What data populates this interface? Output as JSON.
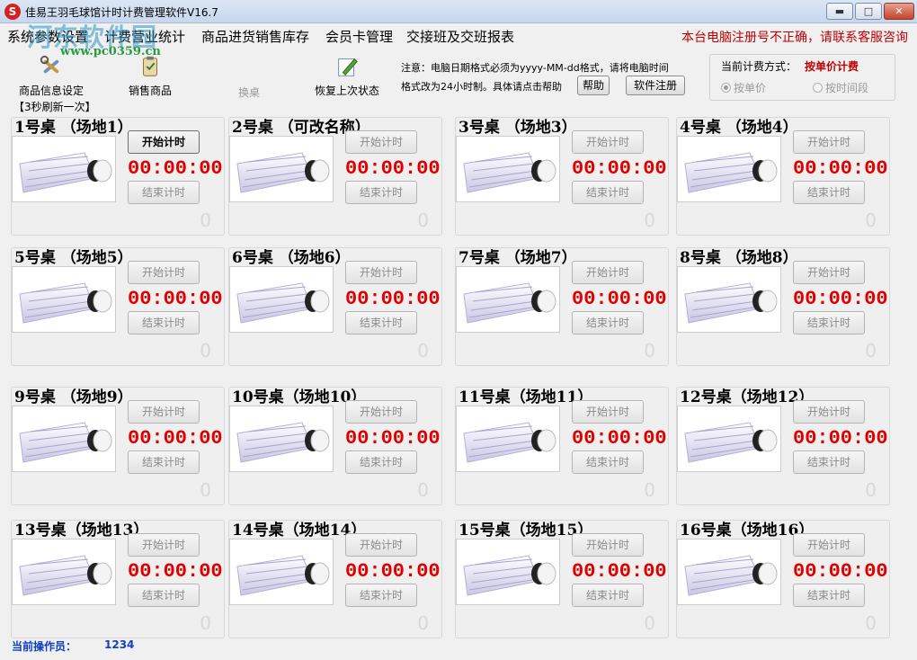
{
  "window": {
    "title": "佳易王羽毛球馆计时计费管理软件V16.7",
    "icon_glyph": "S",
    "btn_min": "▬",
    "btn_max": "□",
    "btn_close": "✕"
  },
  "watermark": {
    "text": "河东软件园",
    "url": "www.pc0359.cn"
  },
  "menu": {
    "items": [
      "系统参数设置",
      "计费营业统计",
      "商品进货销售库存",
      "会员卡管理",
      "交接班及交班报表"
    ],
    "reg_warning": "本台电脑注册号不正确，请联系客服咨询"
  },
  "toolbar": {
    "product_info": "商品信息设定",
    "sell_product": "销售商品",
    "change_table": "换桌",
    "restore_state": "恢复上次状态",
    "notice_line1": "注意：电脑日期格式必须为yyyy-MM-dd格式，请将电脑时间",
    "notice_line2": "格式改为24小时制。具体请点击帮助",
    "help_button": "帮助",
    "register_button": "软件注册"
  },
  "fee": {
    "label": "当前计费方式：",
    "value": "按单价计费",
    "opt_unit": "按单价",
    "opt_period": "按时间段"
  },
  "refresh_label": "【3秒刷新一次】",
  "tables": [
    {
      "title": "1号桌  （场地1）",
      "time": "00:00:00",
      "count": "0",
      "start": "开始计时",
      "stop": "结束计时"
    },
    {
      "title": "2号桌  （可改名称）",
      "time": "00:00:00",
      "count": "0",
      "start": "开始计时",
      "stop": "结束计时"
    },
    {
      "title": "3号桌  （场地3）",
      "time": "00:00:00",
      "count": "0",
      "start": "开始计时",
      "stop": "结束计时"
    },
    {
      "title": "4号桌  （场地4）",
      "time": "00:00:00",
      "count": "0",
      "start": "开始计时",
      "stop": "结束计时"
    },
    {
      "title": "5号桌  （场地5）",
      "time": "00:00:00",
      "count": "0",
      "start": "开始计时",
      "stop": "结束计时"
    },
    {
      "title": "6号桌  （场地6）",
      "time": "00:00:00",
      "count": "0",
      "start": "开始计时",
      "stop": "结束计时"
    },
    {
      "title": "7号桌  （场地7）",
      "time": "00:00:00",
      "count": "0",
      "start": "开始计时",
      "stop": "结束计时"
    },
    {
      "title": "8号桌  （场地8）",
      "time": "00:00:00",
      "count": "0",
      "start": "开始计时",
      "stop": "结束计时"
    },
    {
      "title": "9号桌  （场地9）",
      "time": "00:00:00",
      "count": "0",
      "start": "开始计时",
      "stop": "结束计时"
    },
    {
      "title": "10号桌（场地10）",
      "time": "00:00:00",
      "count": "0",
      "start": "开始计时",
      "stop": "结束计时"
    },
    {
      "title": "11号桌（场地11）",
      "time": "00:00:00",
      "count": "0",
      "start": "开始计时",
      "stop": "结束计时"
    },
    {
      "title": "12号桌（场地12）",
      "time": "00:00:00",
      "count": "0",
      "start": "开始计时",
      "stop": "结束计时"
    },
    {
      "title": "13号桌（场地13）",
      "time": "00:00:00",
      "count": "0",
      "start": "开始计时",
      "stop": "结束计时"
    },
    {
      "title": "14号桌（场地14）",
      "time": "00:00:00",
      "count": "0",
      "start": "开始计时",
      "stop": "结束计时"
    },
    {
      "title": "15号桌（场地15）",
      "time": "00:00:00",
      "count": "0",
      "start": "开始计时",
      "stop": "结束计时"
    },
    {
      "title": "16号桌（场地16）",
      "time": "00:00:00",
      "count": "0",
      "start": "开始计时",
      "stop": "结束计时"
    }
  ],
  "status": {
    "operator_label": "当前操作员：",
    "operator_value": "1234"
  },
  "colors": {
    "timer": "#e00000",
    "warning": "#c00000",
    "status": "#1040c0"
  },
  "icons": {
    "tools": "tools-icon",
    "clipboard": "clipboard-icon",
    "pencil": "pencil-icon",
    "shuttlecock": "shuttlecock-icon"
  }
}
